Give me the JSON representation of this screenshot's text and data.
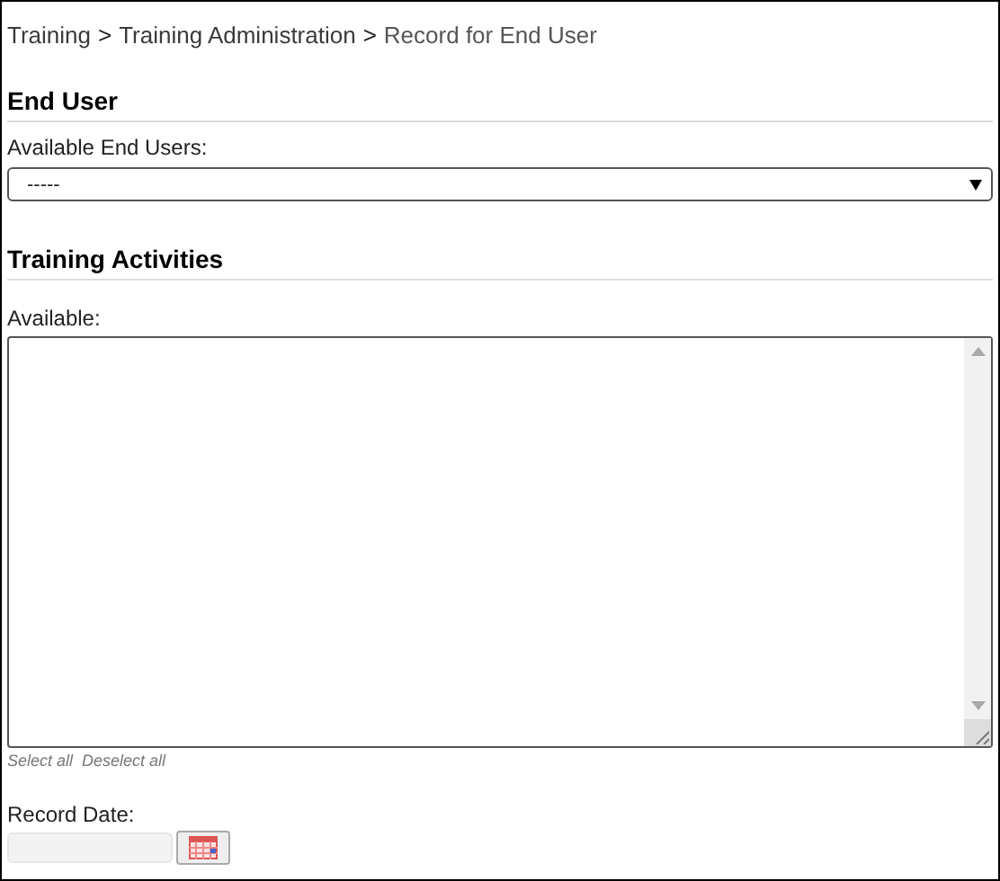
{
  "breadcrumb": [
    {
      "kind": "link",
      "text": "Training"
    },
    {
      "kind": "separator",
      "text": ">"
    },
    {
      "kind": "link",
      "text": "Training Administration"
    },
    {
      "kind": "separator",
      "text": ">"
    },
    {
      "kind": "current",
      "text": "Record for End User"
    }
  ],
  "end_user": {
    "heading": "End User",
    "label": "Available End Users:",
    "value": "-----"
  },
  "training_activities": {
    "heading": "Training Activities",
    "label": "Available:",
    "links": [
      "Select all",
      "Deselect all"
    ]
  },
  "record_date": {
    "label": "Record Date:"
  }
}
